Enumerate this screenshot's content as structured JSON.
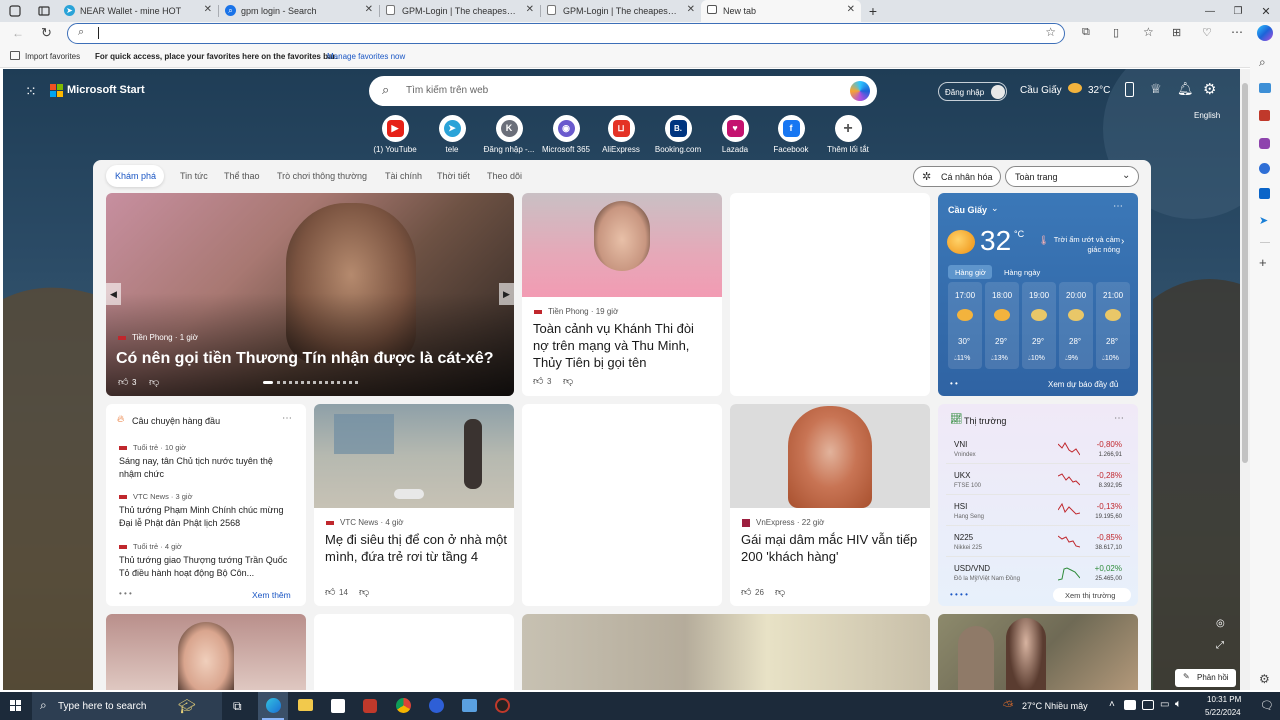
{
  "tabs": [
    {
      "title": "NEAR Wallet - mine HOT",
      "icon_color": "#2aa3d8",
      "icon": "telegram-icon"
    },
    {
      "title": "gpm login - Search",
      "icon_color": "#1a73e8",
      "icon": "search-icon"
    },
    {
      "title": "GPM-Login | The cheapest and b",
      "icon_color": "#888888",
      "icon": "page-icon"
    },
    {
      "title": "GPM-Login | The cheapest and b",
      "icon_color": "#888888",
      "icon": "page-icon"
    },
    {
      "title": "New tab",
      "icon_color": "#555555",
      "icon": "newtab-icon"
    }
  ],
  "favbar": {
    "import": "Import favorites",
    "hint": "For quick access, place your favorites here on the favorites bar.",
    "manage": "Manage favorites now"
  },
  "header": {
    "brand": "Microsoft Start",
    "search_placeholder": "Tìm kiếm trên web",
    "signin": "Đăng nhập",
    "location": "Cầu Giấy",
    "temp": "32°C",
    "language": "English"
  },
  "quicklinks": [
    {
      "label": "(1) YouTube",
      "color": "#e62117",
      "glyph": "▶"
    },
    {
      "label": "tele",
      "color": "#2aa3d8",
      "glyph": "➤"
    },
    {
      "label": "Đăng nhập -...",
      "color": "#6b6f7a",
      "glyph": "K"
    },
    {
      "label": "Microsoft 365",
      "color": "#6a5acd",
      "glyph": "◉"
    },
    {
      "label": "AliExpress",
      "color": "#e43225",
      "glyph": "⊔"
    },
    {
      "label": "Booking.com",
      "color": "#003580",
      "glyph": "B."
    },
    {
      "label": "Lazada",
      "color": "#c4126f",
      "glyph": "♥"
    },
    {
      "label": "Facebook",
      "color": "#1877f2",
      "glyph": "f"
    },
    {
      "label": "Thêm lối tắt",
      "color": "#ffffff",
      "glyph": "+"
    }
  ],
  "nav": {
    "tabs": [
      "Khám phá",
      "Tin tức",
      "Thể thao",
      "Trò chơi thông thường",
      "Tài chính",
      "Thời tiết",
      "Theo dõi"
    ],
    "personalize": "Cá nhân hóa",
    "layout_select": "Toàn trang"
  },
  "hero": {
    "source": "Tiền Phong · 1 giờ",
    "title": "Có nên gọi tiền Thương Tín nhận được là cát-xê?",
    "likes": "3"
  },
  "card2": {
    "source": "Tiền Phong · 19 giờ",
    "title": "Toàn cảnh vụ Khánh Thi đòi nợ trên mạng và Thu Minh, Thủy Tiên bị gọi tên",
    "likes": "3"
  },
  "weather": {
    "location": "Cầu Giấy",
    "temp": "32",
    "unit": "°C",
    "desc": "Trời ẩm ướt và cảm giác nóng",
    "tab_hourly": "Hàng giờ",
    "tab_daily": "Hàng ngày",
    "hours": [
      {
        "time": "17:00",
        "temp": "30°",
        "rain": "11%"
      },
      {
        "time": "18:00",
        "temp": "29°",
        "rain": "13%"
      },
      {
        "time": "19:00",
        "temp": "29°",
        "rain": "10%"
      },
      {
        "time": "20:00",
        "temp": "28°",
        "rain": "9%"
      },
      {
        "time": "21:00",
        "temp": "28°",
        "rain": "10%"
      }
    ],
    "more": "Xem dự báo đầy đủ"
  },
  "top_stories": {
    "header": "Câu chuyện hàng đầu",
    "items": [
      {
        "source": "Tuổi trẻ · 10 giờ",
        "title": "Sáng nay, tân Chủ tịch nước tuyên thệ nhậm chức"
      },
      {
        "source": "VTC News · 3 giờ",
        "title": "Thủ tướng Phạm Minh Chính chúc mừng Đại lễ Phật đản Phật lịch 2568"
      },
      {
        "source": "Tuổi trẻ · 4 giờ",
        "title": "Thủ tướng giao Thượng tướng Trần Quốc Tỏ điều hành hoạt động Bộ Côn..."
      }
    ],
    "more": "Xem thêm"
  },
  "card_vtc": {
    "source": "VTC News · 4 giờ",
    "title": "Mẹ đi siêu thị để con ở nhà một mình, đứa trẻ rơi từ tầng 4",
    "likes": "14"
  },
  "card_vnx": {
    "source": "VnExpress · 22 giờ",
    "title": "Gái mại dâm mắc HIV vẫn tiếp 200 'khách hàng'",
    "likes": "26"
  },
  "market": {
    "header": "Thị trường",
    "rows": [
      {
        "sym": "VNI",
        "name": "Vnindex",
        "chg": "-0,80%",
        "val": "1.266,91",
        "color": "#c0272d"
      },
      {
        "sym": "UKX",
        "name": "FTSE 100",
        "chg": "-0,28%",
        "val": "8.392,95",
        "color": "#c0272d"
      },
      {
        "sym": "HSI",
        "name": "Hang Seng",
        "chg": "-0,13%",
        "val": "19.195,60",
        "color": "#c0272d"
      },
      {
        "sym": "N225",
        "name": "Nikkei 225",
        "chg": "-0,85%",
        "val": "38.617,10",
        "color": "#c0272d"
      },
      {
        "sym": "USD/VND",
        "name": "Đô la Mỹ/Việt Nam Đồng",
        "chg": "+0,02%",
        "val": "25.465,00",
        "color": "#2e8b3a"
      }
    ],
    "more": "Xem thị trường"
  },
  "feedback": "Phản hồi",
  "taskbar": {
    "search": "Type here to search",
    "weather": "27°C Nhiều mây",
    "time": "10:31 PM",
    "date": "5/22/2024"
  }
}
